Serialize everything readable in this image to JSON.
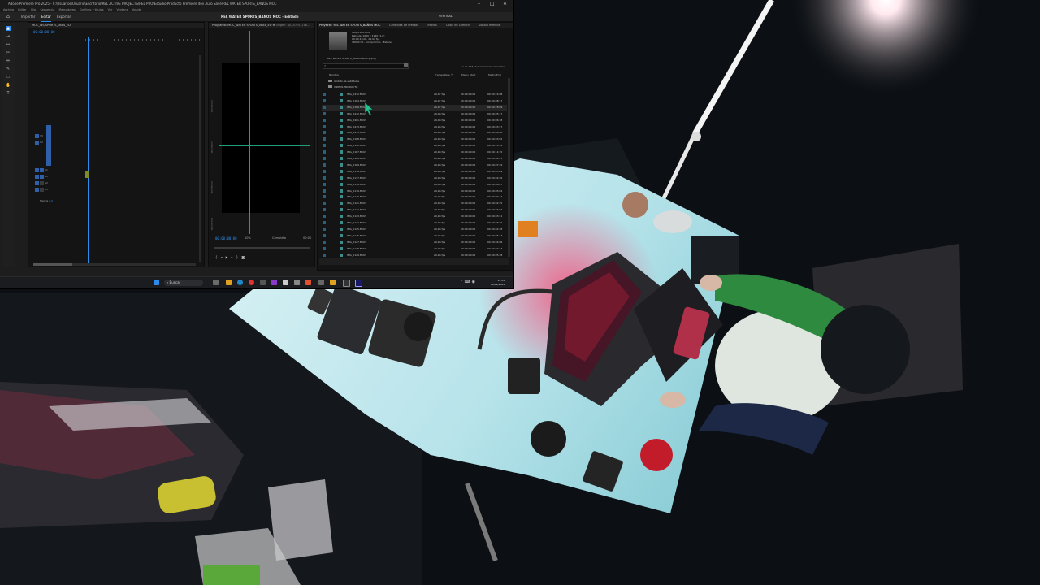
{
  "app": {
    "title": "Adobe Premiere Pro 2025 - C:\\Usuarios\\Usuario\\Escritorio\\REL ACTIVE PROJECTS\\REL PRO\\Estudio Producto Premiere dev Auto Save\\REL WATER SPORTS_BAÑOS MOC",
    "window_controls": [
      "–",
      "□",
      "✕"
    ]
  },
  "menu": [
    "Archivo",
    "Editar",
    "Clip",
    "Secuencia",
    "Marcadores",
    "Gráficos y títulos",
    "Ver",
    "Ventana",
    "Ayuda"
  ],
  "nav": {
    "tabs": [
      "Importar",
      "Editar",
      "Exportar"
    ],
    "active": "Editar",
    "project_name": "REL WATER SPORTS_BAÑOS MOC - Editado",
    "workspace": "VERTICAL"
  },
  "timeline": {
    "header": "MOC_WS/SPORTS_0884_ED",
    "timecode": "00:00:00:00",
    "track_labels": [
      "V3",
      "V2",
      "V1",
      "A1",
      "A2",
      "A3",
      "Mezcla"
    ],
    "mix_value": "0,0"
  },
  "program": {
    "header": "Programa: MOC_WATER SPORTS_0884_ED ≡",
    "source_header": "Origen: DJI_20251216...",
    "timecode": "00:00:00:00",
    "zoom": "10%",
    "quality": "Completa",
    "duration": "00:00",
    "side_labels": [
      "Contenido",
      "Contenido",
      "Contenido",
      "Contenido"
    ]
  },
  "project": {
    "tabs": [
      "Proyecto: REL WATER SPORTS_BAÑOS MOC",
      "Controles de efectos",
      "Efectos",
      "Color de Lumetri",
      "Sonido esencial"
    ],
    "clip_meta": "IMG_0189.MOV\nPelícula, 1080 x 1920 (1,0)\n00:00:10:00, 29,97 fps\n48000 Hz - Comprimido - Estéreo",
    "path": "REL WATER SPORTS_BAÑOS MOC.prproj",
    "count": "1 de 193 elementos seleccionados",
    "columns": [
      "Nombre",
      "Frames Rate ↑",
      "Medio Start",
      "Medio End"
    ],
    "folders": [
      "Ámbito de subtítulos",
      "VÍDEOS PRODUCTO"
    ],
    "rows": [
      {
        "name": "IMG_0412.MOV",
        "fps": "29,97 fps",
        "start": "00:00:00:00",
        "end": "00:00:24:08"
      },
      {
        "name": "IMG_0184.MOV",
        "fps": "29,97 fps",
        "start": "00:00:00:00",
        "end": "00:00:08:17"
      },
      {
        "name": "IMG_0189.MOV",
        "fps": "29,97 fps",
        "start": "00:00:00:00",
        "end": "00:00:28:09"
      },
      {
        "name": "IMG_0412.MOV",
        "fps": "29,98 fps",
        "start": "00:00:00:00",
        "end": "00:00:05:17"
      },
      {
        "name": "IMG_0401.MOV",
        "fps": "29,98 fps",
        "start": "00:00:00:00",
        "end": "00:00:06:18"
      },
      {
        "name": "IMG_0413.MOV",
        "fps": "29,98 fps",
        "start": "00:00:00:00",
        "end": "00:00:03:27"
      },
      {
        "name": "IMG_0415.MOV",
        "fps": "29,98 fps",
        "start": "00:00:00:00",
        "end": "00:00:06:08"
      },
      {
        "name": "IMG_0188.MOV",
        "fps": "29,98 fps",
        "start": "00:00:00:00",
        "end": "00:00:03:02"
      },
      {
        "name": "IMG_0190.MOV",
        "fps": "29,98 fps",
        "start": "00:00:00:00",
        "end": "00:00:10:29"
      },
      {
        "name": "IMG_0187.MOV",
        "fps": "29,98 fps",
        "start": "00:00:00:00",
        "end": "00:00:14:15"
      },
      {
        "name": "IMG_0188.MOV",
        "fps": "29,98 fps",
        "start": "00:00:00:00",
        "end": "00:00:04:21"
      },
      {
        "name": "IMG_0189.MOV",
        "fps": "29,98 fps",
        "start": "00:00:00:00",
        "end": "00:00:07:29"
      },
      {
        "name": "IMG_0116.MOV",
        "fps": "29,98 fps",
        "start": "00:00:00:00",
        "end": "00:00:03:09"
      },
      {
        "name": "IMG_0117.MOV",
        "fps": "29,98 fps",
        "start": "00:00:00:00",
        "end": "00:00:02:26"
      },
      {
        "name": "IMG_0118.MOV",
        "fps": "29,98 fps",
        "start": "00:00:00:00",
        "end": "00:00:06:07"
      },
      {
        "name": "IMG_0119.MOV",
        "fps": "29,98 fps",
        "start": "00:00:00:00",
        "end": "00:00:05:02"
      },
      {
        "name": "IMG_0120.MOV",
        "fps": "29,98 fps",
        "start": "00:00:00:00",
        "end": "00:00:09:17"
      },
      {
        "name": "IMG_0121.MOV",
        "fps": "29,98 fps",
        "start": "00:00:00:00",
        "end": "00:00:02:25"
      },
      {
        "name": "IMG_0122.MOV",
        "fps": "29,98 fps",
        "start": "00:00:00:00",
        "end": "00:00:04:04"
      },
      {
        "name": "IMG_0123.MOV",
        "fps": "29,98 fps",
        "start": "00:00:00:00",
        "end": "00:00:03:21"
      },
      {
        "name": "IMG_0124.MOV",
        "fps": "29,98 fps",
        "start": "00:00:00:00",
        "end": "00:00:03:15"
      },
      {
        "name": "IMG_0125.MOV",
        "fps": "29,98 fps",
        "start": "00:00:00:00",
        "end": "00:00:02:28"
      },
      {
        "name": "IMG_0126.MOV",
        "fps": "29,98 fps",
        "start": "00:00:00:00",
        "end": "00:00:05:13"
      },
      {
        "name": "IMG_0127.MOV",
        "fps": "29,98 fps",
        "start": "00:00:00:00",
        "end": "00:00:04:06"
      },
      {
        "name": "IMG_0128.MOV",
        "fps": "29,98 fps",
        "start": "00:00:00:00",
        "end": "00:00:02:13"
      },
      {
        "name": "IMG_0129.MOV",
        "fps": "29,98 fps",
        "start": "00:00:00:00",
        "end": "00:00:05:28"
      }
    ]
  },
  "taskbar": {
    "search": "Buscar",
    "time": "22:03",
    "date": "09/12/2025",
    "icons": [
      "windows-start-icon",
      "search-icon",
      "chrome-icon",
      "edge-icon",
      "folder-icon",
      "premiere-icon"
    ]
  },
  "colors": {
    "accent": "#2d8ceb",
    "guide": "#1fa07a",
    "cursor": "#22c08f",
    "table_light": "#b9e6ec",
    "jacket_green": "#2e8a3e"
  }
}
